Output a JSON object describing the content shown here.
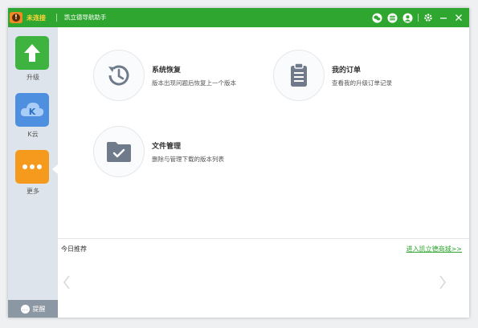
{
  "titlebar": {
    "status_text": "未连接",
    "app_title": "凯立德导航助手",
    "icons": [
      "wechat-icon",
      "message-icon",
      "user-icon",
      "settings-icon",
      "minimize-icon",
      "close-icon"
    ]
  },
  "sidebar": {
    "items": [
      {
        "label": "升级",
        "icon": "upgrade-arrow-icon",
        "color": "#3fb33f"
      },
      {
        "label": "K云",
        "icon": "k-cloud-icon",
        "color": "#4f8fe0"
      },
      {
        "label": "更多",
        "icon": "more-dots-icon",
        "color": "#f59a1c"
      }
    ],
    "feedback_label": "提醒"
  },
  "cards": [
    {
      "title": "系统恢复",
      "desc": "版本出现问题后恢复上一个版本",
      "icon": "history-restore-icon"
    },
    {
      "title": "我的订单",
      "desc": "查看我的升级订单记录",
      "icon": "clipboard-order-icon"
    },
    {
      "title": "文件管理",
      "desc": "删除与管理下载的版本列表",
      "icon": "folder-check-icon"
    }
  ],
  "recommend": {
    "label": "今日推荐",
    "link": "进入凯立德商城>>"
  },
  "colors": {
    "brand_green": "#2ea62f",
    "status_yellow": "#ffd43a",
    "icon_gray": "#6f7a8a"
  }
}
